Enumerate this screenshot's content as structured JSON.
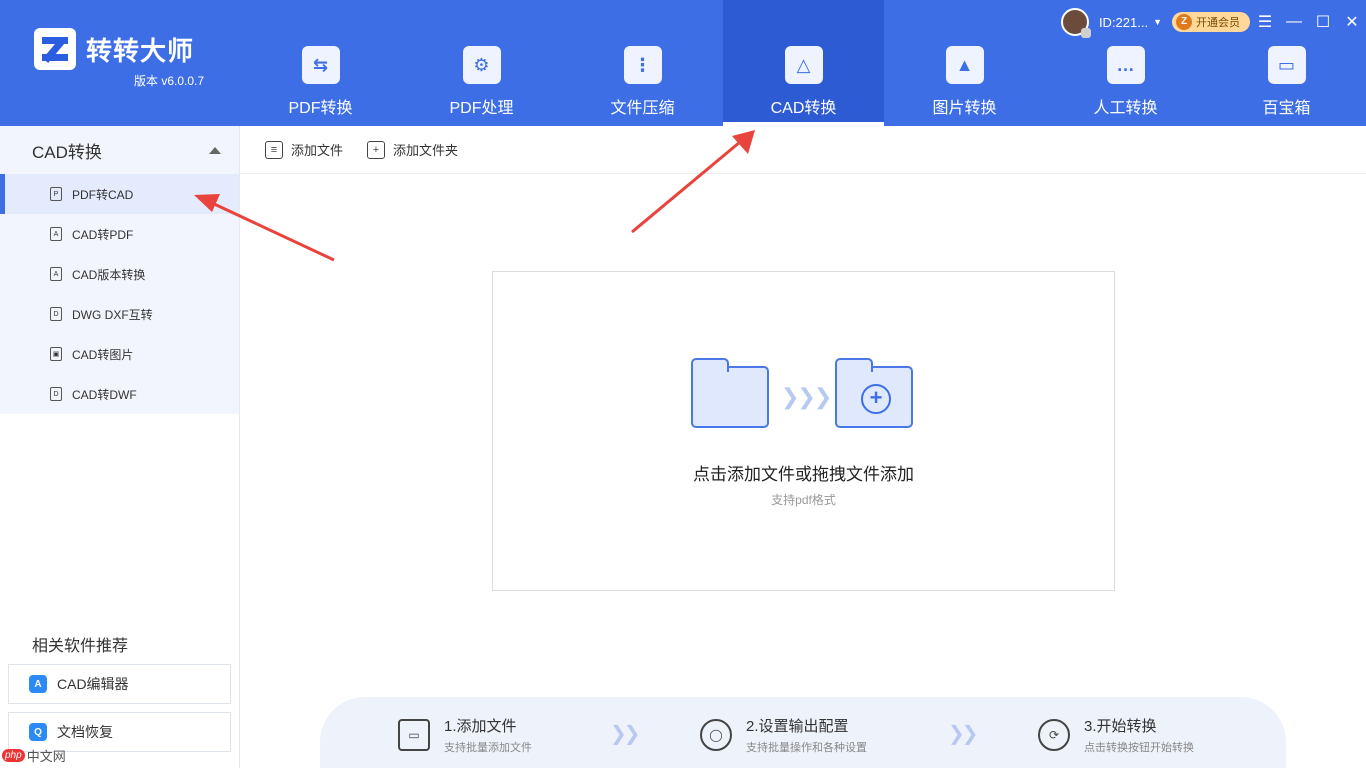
{
  "app": {
    "title": "转转大师",
    "version": "版本 v6.0.0.7"
  },
  "user": {
    "id": "ID:221...",
    "vip_label": "开通会员"
  },
  "window_controls": {
    "menu": "☰",
    "minimize": "—",
    "maximize": "☐",
    "close": "✕"
  },
  "nav": {
    "items": [
      {
        "label": "PDF转换",
        "icon": "pdf-convert-icon",
        "glyph": "⇆",
        "active": false
      },
      {
        "label": "PDF处理",
        "icon": "pdf-process-icon",
        "glyph": "⚙",
        "active": false
      },
      {
        "label": "文件压缩",
        "icon": "zip-icon",
        "glyph": "⋮",
        "active": false
      },
      {
        "label": "CAD转换",
        "icon": "cad-compass-icon",
        "glyph": "△",
        "active": true
      },
      {
        "label": "图片转换",
        "icon": "image-mountain-icon",
        "glyph": "▲",
        "active": false
      },
      {
        "label": "人工转换",
        "icon": "chat-bubble-icon",
        "glyph": "…",
        "active": false
      },
      {
        "label": "百宝箱",
        "icon": "toolbox-icon",
        "glyph": "▭",
        "active": false
      }
    ]
  },
  "sidebar": {
    "group_title": "CAD转换",
    "items": [
      {
        "label": "PDF转CAD",
        "icon": "pdf",
        "glyph": "P",
        "active": true
      },
      {
        "label": "CAD转PDF",
        "icon": "a",
        "glyph": "A",
        "active": false
      },
      {
        "label": "CAD版本转换",
        "icon": "a",
        "glyph": "A",
        "active": false
      },
      {
        "label": "DWG DXF互转",
        "icon": "d",
        "glyph": "D",
        "active": false
      },
      {
        "label": "CAD转图片",
        "icon": "image",
        "glyph": "▣",
        "active": false
      },
      {
        "label": "CAD转DWF",
        "icon": "d",
        "glyph": "D",
        "active": false
      }
    ],
    "recommend_title": "相关软件推荐",
    "recommend": [
      {
        "label": "CAD编辑器",
        "glyph": "A"
      },
      {
        "label": "文档恢复",
        "glyph": "Q"
      }
    ]
  },
  "toolbar": {
    "add_file": "添加文件",
    "add_folder": "添加文件夹"
  },
  "dropzone": {
    "main_text": "点击添加文件或拖拽文件添加",
    "sub_text": "支持pdf格式",
    "chevrons": "❯❯❯"
  },
  "steps": [
    {
      "title": "1.添加文件",
      "desc": "支持批量添加文件"
    },
    {
      "title": "2.设置输出配置",
      "desc": "支持批量操作和各种设置"
    },
    {
      "title": "3.开始转换",
      "desc": "点击转换按钮开始转换"
    }
  ],
  "step_arrow": "❯❯",
  "watermark": {
    "badge": "php",
    "text": "中文网"
  },
  "colors": {
    "brand": "#3d6ee6",
    "active_nav": "#2d5bd4",
    "annotation_arrow": "#e8433c"
  }
}
